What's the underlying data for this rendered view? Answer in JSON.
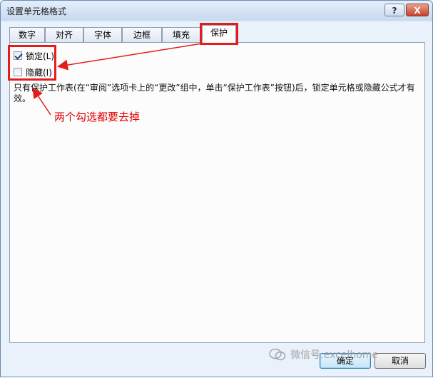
{
  "window": {
    "title": "设置单元格格式",
    "help_label": "?",
    "close_label": "X"
  },
  "tabs": [
    {
      "label": "数字"
    },
    {
      "label": "对齐"
    },
    {
      "label": "字体"
    },
    {
      "label": "边框"
    },
    {
      "label": "填充"
    },
    {
      "label": "保护"
    }
  ],
  "active_tab": "保护",
  "protection": {
    "locked": {
      "label": "锁定(L)",
      "checked": true
    },
    "hidden": {
      "label": "隐藏(I)",
      "checked": false
    },
    "description": "只有保护工作表(在“审阅”选项卡上的“更改”组中，单击“保护工作表”按钮)后，锁定单元格或隐藏公式才有效。"
  },
  "annotation": {
    "text": "两个勾选都要去掉",
    "color": "#e41c1c"
  },
  "buttons": {
    "ok": "确定",
    "cancel": "取消"
  },
  "watermark": {
    "text": "微信号:excelhome",
    "icon": "wechat-icon"
  }
}
